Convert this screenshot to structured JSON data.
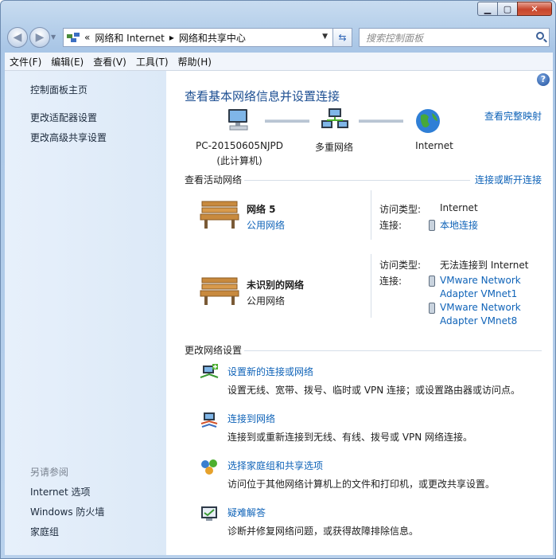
{
  "window": {
    "minimize": "▁",
    "maximize": "▢",
    "close": "✕"
  },
  "address": {
    "prefix": "«",
    "path": [
      "网络和 Internet",
      "网络和共享中心"
    ],
    "separator": "▸",
    "search_placeholder": "搜索控制面板"
  },
  "menu": [
    "文件(F)",
    "编辑(E)",
    "查看(V)",
    "工具(T)",
    "帮助(H)"
  ],
  "sidebar": {
    "home": "控制面板主页",
    "items": [
      "更改适配器设置",
      "更改高级共享设置"
    ],
    "see_also_title": "另请参阅",
    "see_also": [
      "Internet 选项",
      "Windows 防火墙",
      "家庭组"
    ]
  },
  "main": {
    "title": "查看基本网络信息并设置连接",
    "full_map": "查看完整映射",
    "map": {
      "computer_name": "PC-20150605NJPD",
      "computer_sub": "(此计算机)",
      "middle": "多重网络",
      "internet": "Internet"
    },
    "active_header": "查看活动网络",
    "connect_disconnect": "连接或断开连接",
    "networks": [
      {
        "name": "网络  5",
        "category": "公用网络",
        "access_label": "访问类型:",
        "access_value": "Internet",
        "connections_label": "连接:",
        "connections": [
          "本地连接"
        ]
      },
      {
        "name": "未识别的网络",
        "category": "公用网络",
        "access_label": "访问类型:",
        "access_value": "无法连接到 Internet",
        "connections_label": "连接:",
        "connections": [
          "VMware Network\nAdapter VMnet1",
          "VMware Network\nAdapter VMnet8"
        ]
      }
    ],
    "change_header": "更改网络设置",
    "tasks": [
      {
        "title": "设置新的连接或网络",
        "desc": "设置无线、宽带、拨号、临时或 VPN 连接；或设置路由器或访问点。",
        "icon": "new-connection-icon"
      },
      {
        "title": "连接到网络",
        "desc": "连接到或重新连接到无线、有线、拨号或 VPN 网络连接。",
        "icon": "connect-network-icon"
      },
      {
        "title": "选择家庭组和共享选项",
        "desc": "访问位于其他网络计算机上的文件和打印机，或更改共享设置。",
        "icon": "homegroup-icon"
      },
      {
        "title": "疑难解答",
        "desc": "诊断并修复网络问题，或获得故障排除信息。",
        "icon": "troubleshoot-icon"
      }
    ]
  }
}
